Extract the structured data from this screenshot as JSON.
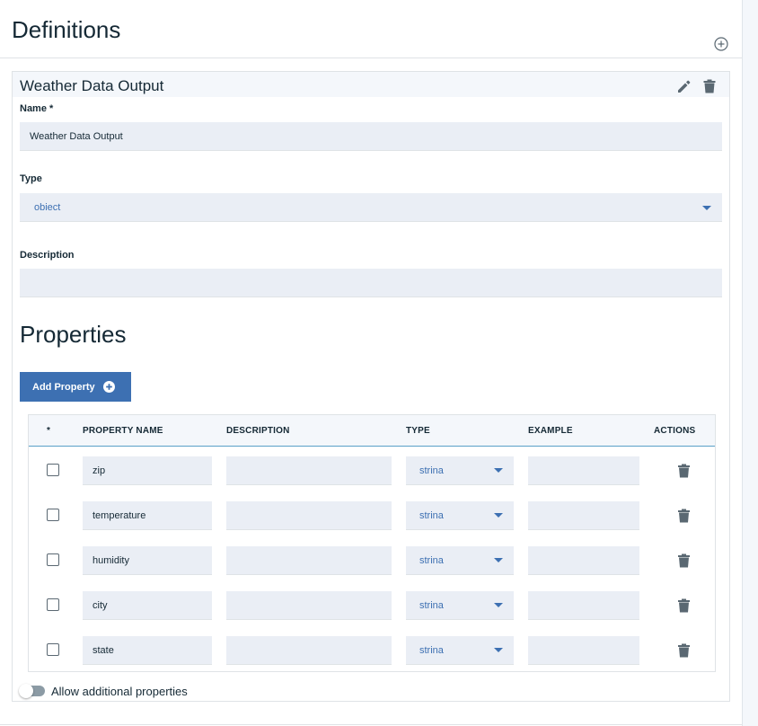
{
  "header": {
    "title": "Definitions",
    "add_icon": "plus-circle-icon"
  },
  "definition": {
    "title": "Weather Data Output",
    "edit_icon": "pencil-icon",
    "delete_icon": "trash-icon",
    "name_label": "Name *",
    "name_value": "Weather Data Output",
    "type_label": "Type",
    "type_value": "obiect",
    "description_label": "Description",
    "description_value": ""
  },
  "properties": {
    "title": "Properties",
    "add_button_label": "Add Property",
    "columns": {
      "select": "*",
      "name": "PROPERTY NAME",
      "description": "DESCRIPTION",
      "type": "TYPE",
      "example": "EXAMPLE",
      "actions": "ACTIONS"
    },
    "rows": [
      {
        "name": "zip",
        "description": "",
        "type": "strina",
        "example": ""
      },
      {
        "name": "temperature",
        "description": "",
        "type": "strina",
        "example": ""
      },
      {
        "name": "humidity",
        "description": "",
        "type": "strina",
        "example": ""
      },
      {
        "name": "city",
        "description": "",
        "type": "strina",
        "example": ""
      },
      {
        "name": "state",
        "description": "",
        "type": "strina",
        "example": ""
      }
    ],
    "allow_additional_label": "Allow additional properties",
    "allow_additional_enabled": false
  },
  "colors": {
    "accent": "#3d70b2",
    "field_bg": "#eaeef5",
    "header_bg": "#f4f7fb",
    "text": "#152935",
    "icon": "#5a6872"
  }
}
